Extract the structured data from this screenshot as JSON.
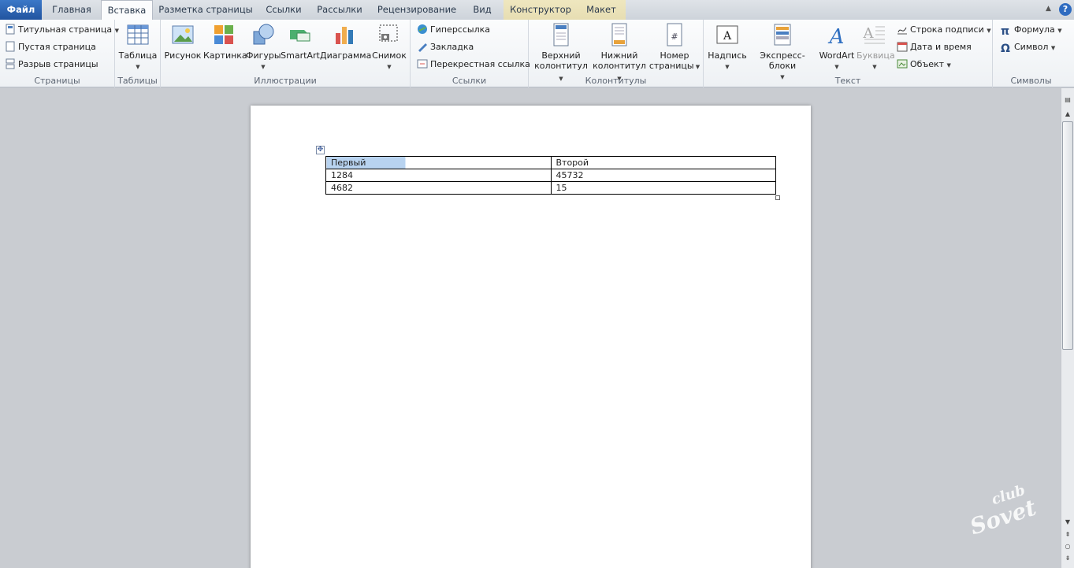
{
  "tabs": {
    "file": "Файл",
    "home": "Главная",
    "insert": "Вставка",
    "layout": "Разметка страницы",
    "refs": "Ссылки",
    "mailings": "Рассылки",
    "review": "Рецензирование",
    "view": "Вид",
    "design": "Конструктор",
    "layout2": "Макет"
  },
  "ribbon": {
    "pages": {
      "cover": "Титульная страница",
      "blank": "Пустая страница",
      "break": "Разрыв страницы",
      "label": "Страницы"
    },
    "tables": {
      "table": "Таблица",
      "label": "Таблицы"
    },
    "illus": {
      "picture": "Рисунок",
      "clipart": "Картинка",
      "shapes": "Фигуры",
      "smartart": "SmartArt",
      "chart": "Диаграмма",
      "screenshot": "Снимок",
      "label": "Иллюстрации"
    },
    "links": {
      "hyperlink": "Гиперссылка",
      "bookmark": "Закладка",
      "crossref": "Перекрестная ссылка",
      "label": "Ссылки"
    },
    "hf": {
      "header1": "Верхний",
      "header2": "колонтитул",
      "footer1": "Нижний",
      "footer2": "колонтитул",
      "pnum1": "Номер",
      "pnum2": "страницы",
      "label": "Колонтитулы"
    },
    "text": {
      "textbox": "Надпись",
      "quickparts": "Экспресс-блоки",
      "wordart": "WordArt",
      "dropcap": "Буквица",
      "sigline": "Строка подписи",
      "datetime": "Дата и время",
      "object": "Объект",
      "label": "Текст"
    },
    "symbols": {
      "equation": "Формула",
      "symbol": "Символ",
      "label": "Символы"
    }
  },
  "table": {
    "rows": [
      [
        "Первый",
        "Второй"
      ],
      [
        "1284",
        "45732"
      ],
      [
        "4682",
        "15"
      ]
    ]
  },
  "watermark": {
    "line1": "club",
    "line2": "Sovet"
  }
}
